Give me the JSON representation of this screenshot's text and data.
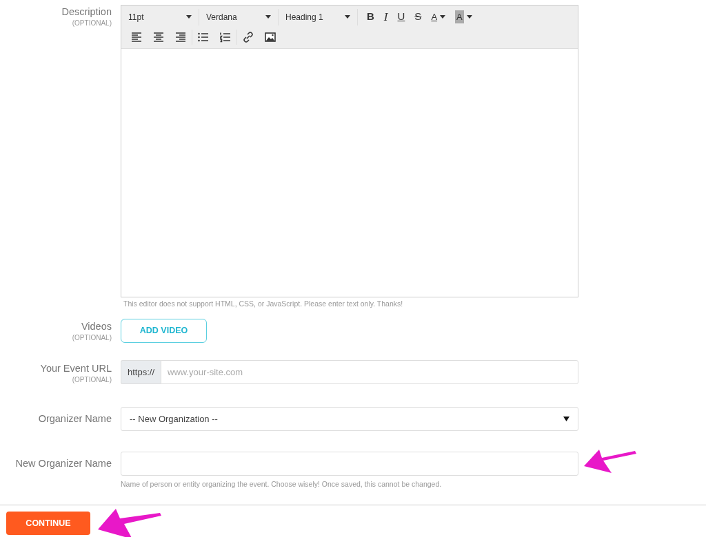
{
  "fields": [
    {
      "kind": "editor",
      "label": "Description",
      "optional": "(OPTIONAL)",
      "dropdowns": [
        "11pt",
        "Verdana",
        "Heading 1"
      ],
      "format_buttons": [
        {
          "kind": "bold",
          "label": "B"
        },
        {
          "kind": "italic",
          "label": "I"
        },
        {
          "kind": "underline",
          "label": "U"
        },
        {
          "kind": "strike",
          "label": "S"
        },
        {
          "kind": "text-color",
          "label": "A"
        },
        {
          "kind": "highlight",
          "label": "A"
        }
      ],
      "help": "This editor does not support HTML, CSS, or JavaScript. Please enter text only. Thanks!"
    },
    {
      "kind": "button",
      "label": "Videos",
      "optional": "(OPTIONAL)",
      "button": "ADD VIDEO"
    },
    {
      "kind": "url",
      "label": "Your Event URL",
      "optional": "(OPTIONAL)",
      "prefix": "https://",
      "placeholder": "www.your-site.com"
    },
    {
      "kind": "select",
      "label": "Organizer Name",
      "value": "-- New Organization --"
    },
    {
      "kind": "text",
      "label": "New Organizer Name",
      "help": "Name of person or entity organizing the event. Choose wisely! Once saved, this cannot be changed.",
      "annotated": true
    }
  ],
  "continue_button": "CONTINUE",
  "continue_annotated": true
}
